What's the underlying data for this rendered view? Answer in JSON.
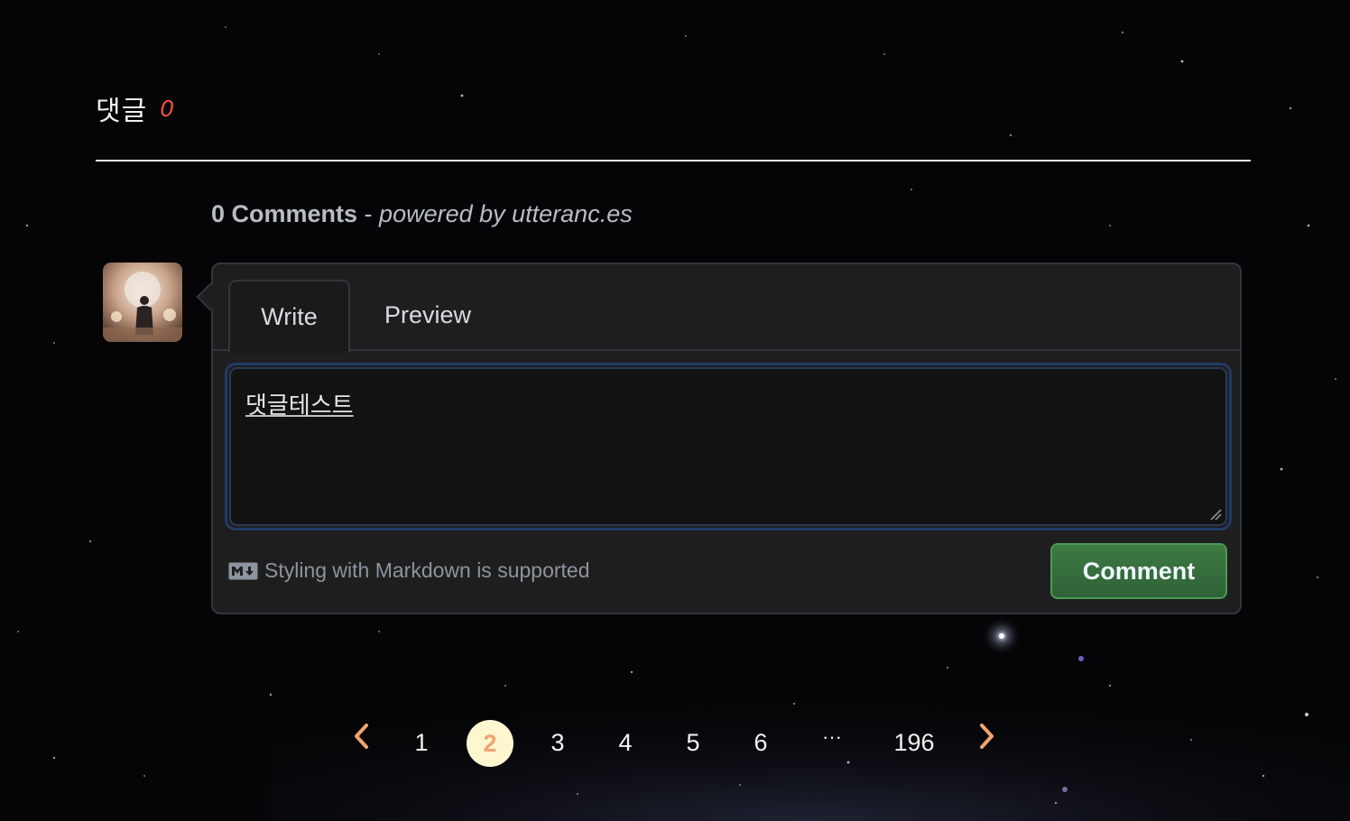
{
  "section": {
    "title": "댓글",
    "count": "0"
  },
  "comments": {
    "count_text": "0 Comments",
    "separator": " - ",
    "powered_by": "powered by utteranc.es"
  },
  "editor": {
    "tabs": [
      {
        "label": "Write",
        "active": true
      },
      {
        "label": "Preview",
        "active": false
      }
    ],
    "textarea_value": "댓글테스트",
    "markdown_hint": "Styling with Markdown is supported",
    "markdown_icon": "markdown-icon",
    "submit_label": "Comment"
  },
  "avatar": {
    "icon": "user-photo"
  },
  "pagination": {
    "prev_icon": "chevron-left-icon",
    "next_icon": "chevron-right-icon",
    "pages": [
      "1",
      "2",
      "3",
      "4",
      "5",
      "6"
    ],
    "current": "2",
    "ellipsis": "···",
    "last": "196",
    "accent": "#f0a56e"
  },
  "colors": {
    "brand_green": "#347d39",
    "title_count_red": "#e8503a"
  }
}
